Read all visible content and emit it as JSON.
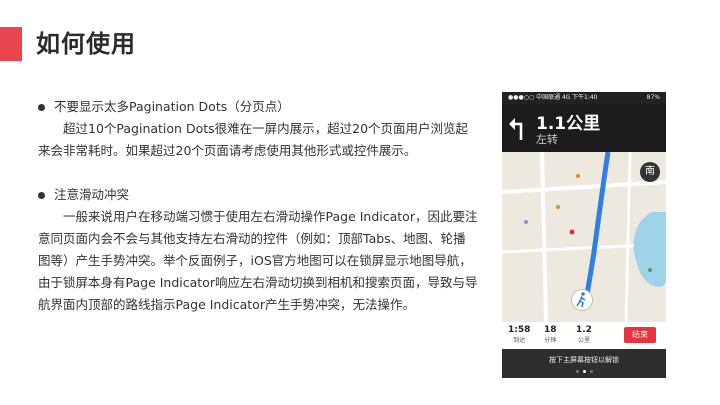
{
  "slide": {
    "title": "如何使用",
    "accent_color": "#e8454f"
  },
  "sections": [
    {
      "bullet": "不要显示太多Pagination Dots（分页点）",
      "body": "超过10个Pagination Dots很难在一屏内展示，超过20个页面用户浏览起来会非常耗时。如果超过20个页面请考虑使用其他形式或控件展示。"
    },
    {
      "bullet": "注意滑动冲突",
      "body": "一般来说用户在移动端习惯于使用左右滑动操作Page Indicator，因此要注意同页面内会不会与其他支持左右滑动的控件（例如：顶部Tabs、地图、轮播图等）产生手势冲突。举个反面例子，iOS官方地图可以在锁屏显示地图导航，由于锁屏本身有Page Indicator响应左右滑动切换到相机和搜索页面，导致与导航界面内顶部的路线指示Page Indicator产生手势冲突，无法操作。"
    }
  ],
  "phone": {
    "status": {
      "carrier": "●●●○○ 中国联通 4G",
      "time": "下午1:40",
      "battery": "87%"
    },
    "nav": {
      "distance": "1.1公里",
      "instruction": "左转",
      "turn_icon": "turn-left-icon"
    },
    "compass": "南",
    "trip": {
      "arrival": "1:58",
      "arrival_label": "到达",
      "minutes": "18",
      "minutes_label": "分钟",
      "km": "1.2",
      "km_label": "公里",
      "end_label": "结束"
    },
    "lock_text": "按下主屏幕按钮以解锁"
  }
}
